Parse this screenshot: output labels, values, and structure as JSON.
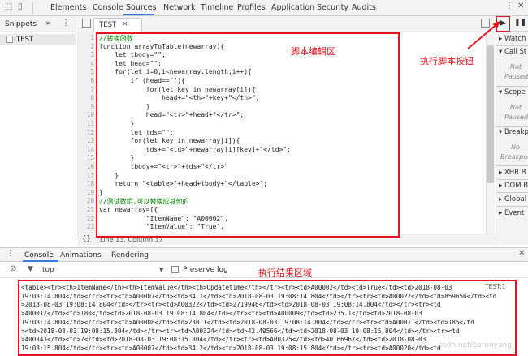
{
  "toolbar": {
    "tabs": [
      "Elements",
      "Console",
      "Sources",
      "Network",
      "Timeline",
      "Profiles",
      "Application",
      "Security",
      "Audits"
    ]
  },
  "left_panel": {
    "tab_label": "Snippets",
    "more": "»",
    "item": "TEST"
  },
  "editor": {
    "tab_label": "TEST",
    "close": "×",
    "lines": [
      "//转换函数",
      "function arrayToTable(newarray){",
      "    let tbody=\"\";",
      "    let head=\"\";",
      "    for(let i=0;i<newarray.length;i++){",
      "        if (head==\"\"){",
      "            for(let key in newarray[i]){",
      "                head+=\"<th>\"+key+\"</th>\";",
      "            }",
      "            head=\"<tr>\"+head+\"</tr>\";",
      "        }",
      "        let tds=\"\";",
      "        for(let key in newarray[i]){",
      "            tds+=\"<td>\"+newarray[i][key]+\"</td>\";",
      "        }",
      "        tbody+=\"<tr>\"+tds+\"</tr>\"",
      "    }",
      "    return \"<table>\"+head+tbody+\"</table>\";",
      "}",
      "//测试数组,可以替换成其他的",
      "var newarray=[{",
      "            \"ItemName\": \"A00002\",",
      "            \"ItemValue\": \"True\","
    ],
    "status": "Line 13, Column 37",
    "braces": "{}"
  },
  "annotations": {
    "editor_area": "脚本编辑区",
    "run_button": "执行脚本按钮",
    "result_area": "执行结果区域"
  },
  "right_panel": {
    "items": [
      "Watch",
      "Call St",
      "Not",
      "Paused",
      "Scope",
      "Not",
      "Paused",
      "Breakp",
      "No",
      "Breakpoi",
      "XHR B",
      "DOM B",
      "Global",
      "Event"
    ]
  },
  "drawer": {
    "tabs": [
      "Console",
      "Animations",
      "Rendering"
    ]
  },
  "console": {
    "context": "top",
    "preserve_log": "Preserve log",
    "source_link": "TEST:1",
    "output_lines": [
      "<table><tr><th>ItemName</th><th>ItemValue</th><th>Updatetime</th></tr><tr><td>A00002</td><td>True</td><td>2018-08-03",
      "19:08:14.804</td></tr><tr><td>A00007</td><td>34.1</td><td>2018-08-03 19:08:14.804</td></tr><tr><td>A00022</td><td>859656</td><td",
      ">2018-08-03 19:08:14.804</td></tr><tr><td>A00322</td><td>2719946</td><td>2018-08-03 19:08:14.804</td></tr><tr><td",
      ">A00012</td><td>180</td><td>2018-08-03 19:08:14.804</td></tr><tr><td>A00009</td><td>235.1</td><td>2018-08-03",
      "19:08:14.804</td></tr><tr><td>A00008</td><td>230.1</td><td>2018-08-03 19:08:14.804</td></tr><tr><td>A00011</td><td>185</td",
      "><td>2018-08-03 19:08:15.804</td></tr><tr><td>A00324</td><td>42.49566</td><td>2018-08-03 19:08:15.804</td></tr><tr><td",
      ">A00343</td><td>7</td><td>2018-08-03 19:08:15.804</td></tr><tr><td>A00325</td><td>40.66967</td><td>2018-08-03",
      "19:08:15.804</td></tr><tr><td>A00007</td><td>34.2</td><td>2018-08-03 19:08:15.804</td></tr><tr><td>A00020</td><td"
    ],
    "watermark": "csdn.net/baronyang"
  }
}
